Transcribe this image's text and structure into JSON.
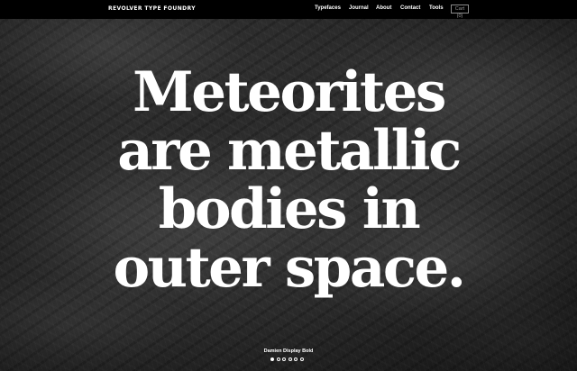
{
  "header": {
    "brand": "REVOLVER TYPE FOUNDRY",
    "nav": {
      "typefaces": "Typefaces",
      "journal": "Journal",
      "about": "About",
      "contact": "Contact",
      "tools": "Tools"
    },
    "cart_label": "Cart (0)"
  },
  "hero": {
    "headline_lines": [
      "Meteorites",
      "are metallic",
      "bodies in",
      "outer space."
    ],
    "font_caption": "Damien Display Bold",
    "slides_total": 6,
    "slide_active": 1
  },
  "colors": {
    "topbar": "#000000",
    "text": "#ffffff",
    "cart_border": "#8a8a8a"
  }
}
